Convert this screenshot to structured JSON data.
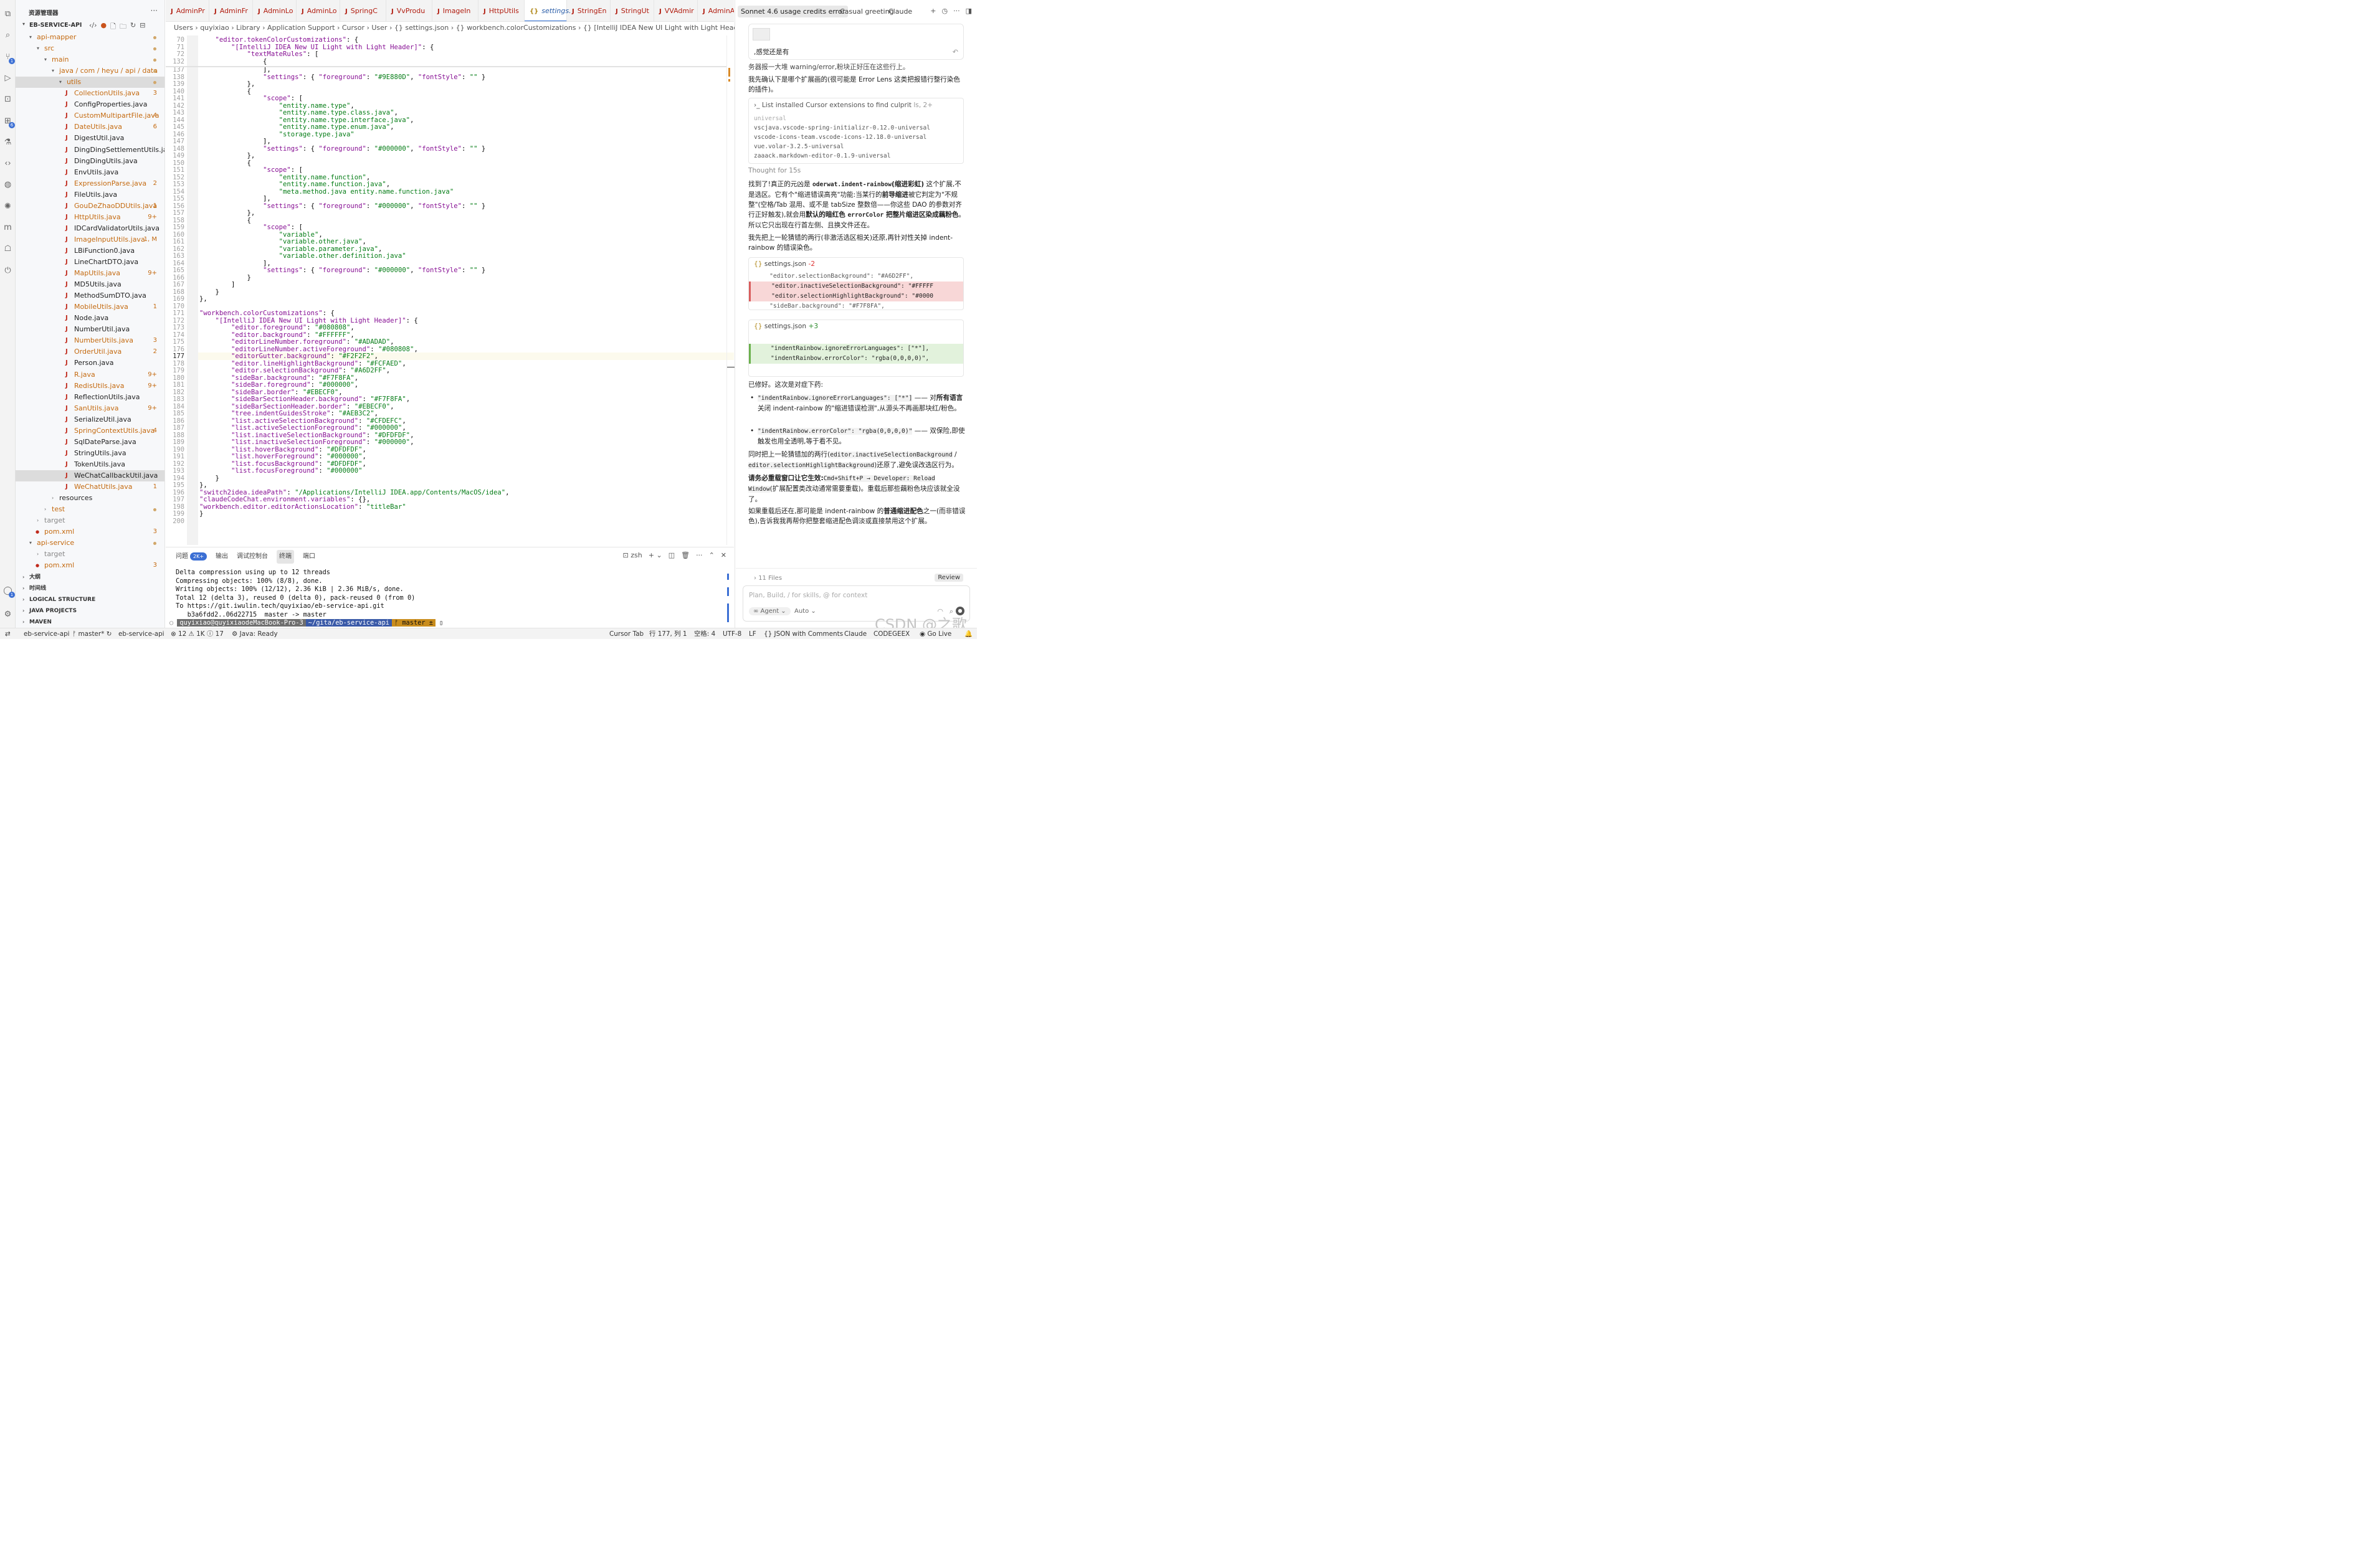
{
  "activity_bar": {
    "items": [
      {
        "icon": "files-icon"
      },
      {
        "icon": "search-icon"
      },
      {
        "icon": "source-control-icon",
        "badge": "1"
      },
      {
        "icon": "run-debug-icon"
      },
      {
        "icon": "remote-explorer-icon"
      },
      {
        "icon": "extensions-icon",
        "badge": "6"
      },
      {
        "icon": "testing-icon"
      },
      {
        "icon": "code-icon"
      },
      {
        "icon": "chat-icon"
      },
      {
        "icon": "spark-icon"
      },
      {
        "icon": "maven-icon"
      },
      {
        "icon": "robot-icon"
      },
      {
        "icon": "power-icon"
      }
    ],
    "bottom": [
      {
        "icon": "account-icon",
        "badge": "1"
      },
      {
        "icon": "gear-icon"
      }
    ]
  },
  "sidebar": {
    "title": "资源管理器",
    "more": "···",
    "project": "EB-SERVICE-API",
    "tree": [
      {
        "label": "api-mapper",
        "depth": 1,
        "kind": "folder",
        "open": true,
        "color": "#c46a10",
        "dot": true
      },
      {
        "label": "src",
        "depth": 2,
        "kind": "folder",
        "open": true,
        "color": "#c46a10",
        "dot": true
      },
      {
        "label": "main",
        "depth": 3,
        "kind": "folder",
        "open": true,
        "color": "#c46a10",
        "dot": true
      },
      {
        "label": "java / com / heyu / api / data",
        "depth": 4,
        "kind": "folder",
        "open": true,
        "color": "#c46a10",
        "dot": true
      },
      {
        "label": "utils",
        "depth": 5,
        "kind": "folder",
        "open": true,
        "color": "#c46a10",
        "dot": true,
        "selected": true
      },
      {
        "label": "CollectionUtils.java",
        "depth": 6,
        "kind": "java",
        "color": "#c46a10",
        "count": "3"
      },
      {
        "label": "ConfigProperties.java",
        "depth": 6,
        "kind": "java",
        "color": "#222"
      },
      {
        "label": "CustomMultipartFile.java",
        "depth": 6,
        "kind": "java",
        "color": "#c46a10",
        "count": "4"
      },
      {
        "label": "DateUtils.java",
        "depth": 6,
        "kind": "java",
        "color": "#c46a10",
        "count": "6"
      },
      {
        "label": "DigestUtil.java",
        "depth": 6,
        "kind": "java",
        "color": "#222"
      },
      {
        "label": "DingDingSettlementUtils.java",
        "depth": 6,
        "kind": "java",
        "color": "#222"
      },
      {
        "label": "DingDingUtils.java",
        "depth": 6,
        "kind": "java",
        "color": "#222"
      },
      {
        "label": "EnvUtils.java",
        "depth": 6,
        "kind": "java",
        "color": "#222"
      },
      {
        "label": "ExpressionParse.java",
        "depth": 6,
        "kind": "java",
        "color": "#c46a10",
        "count": "2"
      },
      {
        "label": "FileUtils.java",
        "depth": 6,
        "kind": "java",
        "color": "#222"
      },
      {
        "label": "GouDeZhaoDDUtils.java",
        "depth": 6,
        "kind": "java",
        "color": "#c46a10",
        "count": "1"
      },
      {
        "label": "HttpUtils.java",
        "depth": 6,
        "kind": "java",
        "color": "#c46a10",
        "count": "9+"
      },
      {
        "label": "IDCardValidatorUtils.java",
        "depth": 6,
        "kind": "java",
        "color": "#222"
      },
      {
        "label": "ImageInputUtils.java",
        "depth": 6,
        "kind": "java",
        "color": "#c46a10",
        "count": "1, M"
      },
      {
        "label": "LBiFunction0.java",
        "depth": 6,
        "kind": "java",
        "color": "#222"
      },
      {
        "label": "LineChartDTO.java",
        "depth": 6,
        "kind": "java",
        "color": "#222"
      },
      {
        "label": "MapUtils.java",
        "depth": 6,
        "kind": "java",
        "color": "#c46a10",
        "count": "9+"
      },
      {
        "label": "MD5Utils.java",
        "depth": 6,
        "kind": "java",
        "color": "#222"
      },
      {
        "label": "MethodSumDTO.java",
        "depth": 6,
        "kind": "java",
        "color": "#222"
      },
      {
        "label": "MobileUtils.java",
        "depth": 6,
        "kind": "java",
        "color": "#c46a10",
        "count": "1"
      },
      {
        "label": "Node.java",
        "depth": 6,
        "kind": "java",
        "color": "#222"
      },
      {
        "label": "NumberUtil.java",
        "depth": 6,
        "kind": "java",
        "color": "#222"
      },
      {
        "label": "NumberUtils.java",
        "depth": 6,
        "kind": "java",
        "color": "#c46a10",
        "count": "3"
      },
      {
        "label": "OrderUtil.java",
        "depth": 6,
        "kind": "java",
        "color": "#c46a10",
        "count": "2"
      },
      {
        "label": "Person.java",
        "depth": 6,
        "kind": "java",
        "color": "#222"
      },
      {
        "label": "R.java",
        "depth": 6,
        "kind": "java",
        "color": "#c46a10",
        "count": "9+"
      },
      {
        "label": "RedisUtils.java",
        "depth": 6,
        "kind": "java",
        "color": "#c46a10",
        "count": "9+"
      },
      {
        "label": "ReflectionUtils.java",
        "depth": 6,
        "kind": "java",
        "color": "#222"
      },
      {
        "label": "SanUtils.java",
        "depth": 6,
        "kind": "java",
        "color": "#c46a10",
        "count": "9+"
      },
      {
        "label": "SerializeUtil.java",
        "depth": 6,
        "kind": "java",
        "color": "#222"
      },
      {
        "label": "SpringContextUtils.java",
        "depth": 6,
        "kind": "java",
        "color": "#c46a10",
        "count": "4"
      },
      {
        "label": "SqlDateParse.java",
        "depth": 6,
        "kind": "java",
        "color": "#222"
      },
      {
        "label": "StringUtils.java",
        "depth": 6,
        "kind": "java",
        "color": "#222"
      },
      {
        "label": "TokenUtils.java",
        "depth": 6,
        "kind": "java",
        "color": "#222"
      },
      {
        "label": "WeChatCallbackUtil.java",
        "depth": 6,
        "kind": "java",
        "color": "#222",
        "selected": true
      },
      {
        "label": "WeChatUtils.java",
        "depth": 6,
        "kind": "java",
        "color": "#c46a10",
        "count": "1"
      },
      {
        "label": "resources",
        "depth": 4,
        "kind": "folder",
        "open": false,
        "color": "#222"
      },
      {
        "label": "test",
        "depth": 3,
        "kind": "folder",
        "open": false,
        "color": "#c46a10",
        "dot": true
      },
      {
        "label": "target",
        "depth": 2,
        "kind": "folder",
        "open": false,
        "color": "#888"
      },
      {
        "label": "pom.xml",
        "depth": 2,
        "kind": "xml",
        "color": "#c46a10",
        "count": "3"
      },
      {
        "label": "api-service",
        "depth": 1,
        "kind": "folder",
        "open": true,
        "color": "#c46a10",
        "dot": true
      },
      {
        "label": "target",
        "depth": 2,
        "kind": "folder",
        "open": false,
        "color": "#888"
      },
      {
        "label": "pom.xml",
        "depth": 2,
        "kind": "xml",
        "color": "#c46a10",
        "count": "3"
      }
    ],
    "sections": [
      "大纲",
      "时间线",
      "LOGICAL STRUCTURE",
      "JAVA PROJECTS",
      "MAVEN"
    ]
  },
  "editor": {
    "tabs": [
      {
        "label": "AdminPr",
        "active": false
      },
      {
        "label": "AdminFr",
        "active": false
      },
      {
        "label": "AdminLo",
        "active": false
      },
      {
        "label": "AdminLo",
        "active": false
      },
      {
        "label": "SpringC",
        "active": false
      },
      {
        "label": "VvProdu",
        "active": false
      },
      {
        "label": "ImageIn",
        "active": false
      },
      {
        "label": "HttpUtils",
        "active": false
      },
      {
        "label": "settings.",
        "active": true
      },
      {
        "label": "StringEn",
        "active": false
      },
      {
        "label": "StringUt",
        "active": false
      },
      {
        "label": "VVAdmir",
        "active": false
      },
      {
        "label": "AdminAp",
        "active": false
      }
    ],
    "breadcrumb": "Users › quyixiao › Library › Application Support › Cursor › User › {} settings.json › {} workbench.colorCustomizations › {} [IntelliJ IDEA New UI Light with Light Header]",
    "current_line": "177",
    "lines": [
      {
        "n": "70",
        "t": "    \"editor.tokenColorCustomizations\": {"
      },
      {
        "n": "71",
        "t": "        \"[IntelliJ IDEA New UI Light with Light Header]\": {"
      },
      {
        "n": "72",
        "t": "            \"textMateRules\": ["
      },
      {
        "n": "132",
        "t": "                {"
      },
      {
        "n": "137",
        "t": "                ],"
      },
      {
        "n": "138",
        "t": "                \"settings\": { \"foreground\": \"#9E880D\", \"fontStyle\": \"\" }"
      },
      {
        "n": "139",
        "t": "            },"
      },
      {
        "n": "140",
        "t": "            {"
      },
      {
        "n": "141",
        "t": "                \"scope\": ["
      },
      {
        "n": "142",
        "t": "                    \"entity.name.type\","
      },
      {
        "n": "143",
        "t": "                    \"entity.name.type.class.java\","
      },
      {
        "n": "144",
        "t": "                    \"entity.name.type.interface.java\","
      },
      {
        "n": "145",
        "t": "                    \"entity.name.type.enum.java\","
      },
      {
        "n": "146",
        "t": "                    \"storage.type.java\""
      },
      {
        "n": "147",
        "t": "                ],"
      },
      {
        "n": "148",
        "t": "                \"settings\": { \"foreground\": \"#000000\", \"fontStyle\": \"\" }"
      },
      {
        "n": "149",
        "t": "            },"
      },
      {
        "n": "150",
        "t": "            {"
      },
      {
        "n": "151",
        "t": "                \"scope\": ["
      },
      {
        "n": "152",
        "t": "                    \"entity.name.function\","
      },
      {
        "n": "153",
        "t": "                    \"entity.name.function.java\","
      },
      {
        "n": "154",
        "t": "                    \"meta.method.java entity.name.function.java\""
      },
      {
        "n": "155",
        "t": "                ],"
      },
      {
        "n": "156",
        "t": "                \"settings\": { \"foreground\": \"#000000\", \"fontStyle\": \"\" }"
      },
      {
        "n": "157",
        "t": "            },"
      },
      {
        "n": "158",
        "t": "            {"
      },
      {
        "n": "159",
        "t": "                \"scope\": ["
      },
      {
        "n": "160",
        "t": "                    \"variable\","
      },
      {
        "n": "161",
        "t": "                    \"variable.other.java\","
      },
      {
        "n": "162",
        "t": "                    \"variable.parameter.java\","
      },
      {
        "n": "163",
        "t": "                    \"variable.other.definition.java\""
      },
      {
        "n": "164",
        "t": "                ],"
      },
      {
        "n": "165",
        "t": "                \"settings\": { \"foreground\": \"#000000\", \"fontStyle\": \"\" }"
      },
      {
        "n": "166",
        "t": "            }"
      },
      {
        "n": "167",
        "t": "        ]"
      },
      {
        "n": "168",
        "t": "    }"
      },
      {
        "n": "169",
        "t": "},"
      },
      {
        "n": "170",
        "t": ""
      },
      {
        "n": "171",
        "t": "\"workbench.colorCustomizations\": {"
      },
      {
        "n": "172",
        "t": "    \"[IntelliJ IDEA New UI Light with Light Header]\": {"
      },
      {
        "n": "173",
        "t": "        \"editor.foreground\": \"#080808\","
      },
      {
        "n": "174",
        "t": "        \"editor.background\": \"#FFFFFF\","
      },
      {
        "n": "175",
        "t": "        \"editorLineNumber.foreground\": \"#ADADAD\","
      },
      {
        "n": "176",
        "t": "        \"editorLineNumber.activeForeground\": \"#080808\","
      },
      {
        "n": "177",
        "t": "        \"editorGutter.background\": \"#F2F2F2\","
      },
      {
        "n": "178",
        "t": "        \"editor.lineHighlightBackground\": \"#FCFAED\","
      },
      {
        "n": "179",
        "t": "        \"editor.selectionBackground\": \"#A6D2FF\","
      },
      {
        "n": "180",
        "t": "        \"sideBar.background\": \"#F7F8FA\","
      },
      {
        "n": "181",
        "t": "        \"sideBar.foreground\": \"#000000\","
      },
      {
        "n": "182",
        "t": "        \"sideBar.border\": \"#EBECF0\","
      },
      {
        "n": "183",
        "t": "        \"sideBarSectionHeader.background\": \"#F7F8FA\","
      },
      {
        "n": "184",
        "t": "        \"sideBarSectionHeader.border\": \"#EBECF0\","
      },
      {
        "n": "185",
        "t": "        \"tree.indentGuidesStroke\": \"#AEB3C2\","
      },
      {
        "n": "186",
        "t": "        \"list.activeSelectionBackground\": \"#CFDEFC\","
      },
      {
        "n": "187",
        "t": "        \"list.activeSelectionForeground\": \"#000000\","
      },
      {
        "n": "188",
        "t": "        \"list.inactiveSelectionBackground\": \"#DFDFDF\","
      },
      {
        "n": "189",
        "t": "        \"list.inactiveSelectionForeground\": \"#000000\","
      },
      {
        "n": "190",
        "t": "        \"list.hoverBackground\": \"#DFDFDF\","
      },
      {
        "n": "191",
        "t": "        \"list.hoverForeground\": \"#000000\","
      },
      {
        "n": "192",
        "t": "        \"list.focusBackground\": \"#DFDFDF\","
      },
      {
        "n": "193",
        "t": "        \"list.focusForeground\": \"#000000\""
      },
      {
        "n": "194",
        "t": "    }"
      },
      {
        "n": "195",
        "t": "},"
      },
      {
        "n": "196",
        "t": "\"switch2idea.ideaPath\": \"/Applications/IntelliJ IDEA.app/Contents/MacOS/idea\","
      },
      {
        "n": "197",
        "t": "\"claudeCodeChat.environment.variables\": {},"
      },
      {
        "n": "198",
        "t": "\"workbench.editor.editorActionsLocation\": \"titleBar\""
      },
      {
        "n": "199",
        "t": "}"
      },
      {
        "n": "200",
        "t": ""
      }
    ]
  },
  "panel": {
    "tabs": [
      "问题",
      "输出",
      "调试控制台",
      "终端",
      "端口"
    ],
    "problems_badge": "2K+",
    "active": "终端",
    "shell": "zsh",
    "terminal": [
      "Delta compression using up to 12 threads",
      "Compressing objects: 100% (8/8), done.",
      "Writing objects: 100% (12/12), 2.36 KiB | 2.36 MiB/s, done.",
      "Total 12 (delta 3), reused 0 (delta 0), pack-reused 0 (from 0)",
      "To https://git.iwulin.tech/quyixiao/eb-service-api.git",
      "   b3a6fdd2..06d22715  master -> master"
    ],
    "prompt_user": "quyixiao@quyixiaodeMacBook-Pro-3",
    "prompt_path": "~/gita/eb-service-api",
    "prompt_branch": "ᚠ master ±"
  },
  "chat": {
    "tabs": [
      "Sonnet 4.6 usage credits error",
      "Casual greeting",
      "Claude"
    ],
    "active_tab": "Sonnet 4.6 usage credits error",
    "quote": ",感觉还是有",
    "p_cut": "务器报一大堆 warning/error,粉块正好压在这些行上。",
    "p1": "我先确认下是哪个扩展画的(很可能是 Error Lens 这类把报错行整行染色的插件)。",
    "tool_title": "List installed Cursor extensions to find culprit",
    "tool_meta": "ls, 2+",
    "tool_output": [
      "universal",
      "vscjava.vscode-spring-initializr-0.12.0-universal",
      "vscode-icons-team.vscode-icons-12.18.0-universal",
      "vue.volar-3.2.5-universal",
      "zaaack.markdown-editor-0.1.9-universal"
    ],
    "thought_label": "Thought",
    "thought_time": "for 15s",
    "p2a": "找到了!真正的元凶是 ",
    "p2code": "oderwat.indent-rainbow",
    "p2b": "(缩进彩虹)",
    "p2c": " 这个扩展,不是选区。它有个\"缩进错误高亮\"功能:当某行的",
    "p2d": "前导缩进",
    "p2e": "被它判定为\"不规整\"(空格/Tab 混用、或不是 tabSize 整数倍——你这些 DAO 的参数对齐行正好触发),就会用",
    "p2f": "默认的暗红色 ",
    "p2code2": "errorColor",
    "p2g": " 把整片缩进区染成藕粉色",
    "p2h": "。所以它只出现在行首左侧、且换文件还在。",
    "p3": "我先把上一轮猜错的两行(非激活选区相关)还原,再针对性关掉 indent-rainbow 的错误染色。",
    "diff1": {
      "file": "settings.json",
      "stat": "-2",
      "lines": [
        {
          "t": "    \"editor.selectionBackground\": \"#A6D2FF\",",
          "kind": "ctx"
        },
        {
          "t": "    \"editor.inactiveSelectionBackground\": \"#FFFFF",
          "kind": "del"
        },
        {
          "t": "    \"editor.selectionHighlightBackground\": \"#0000",
          "kind": "del"
        },
        {
          "t": "    \"sideBar.background\": \"#F7F8FA\",",
          "kind": "ctx"
        }
      ]
    },
    "diff2": {
      "file": "settings.json",
      "stat": "+3",
      "lines": [
        {
          "t": "\"indentRainbow.ignoreErrorLanguages\": [\"*\"],",
          "kind": "add"
        },
        {
          "t": "\"indentRainbow.errorColor\": \"rgba(0,0,0,0)\",",
          "kind": "add"
        }
      ]
    },
    "p4": "已修好。这次是对症下药:",
    "b1code": "\"indentRainbow.ignoreErrorLanguages\": [\"*\"]",
    "b1a": " —— 对",
    "b1b": "所有语言",
    "b1c": "关闭 indent-rainbow 的\"缩进错误检测\",从源头不再画那块红/粉色。",
    "b2code": "\"indentRainbow.errorColor\": \"rgba(0,0,0,0)\"",
    "b2a": " —— 双保险,即使触发也用全透明,等于看不见。",
    "p5a": "同时把上一轮猜错加的两行(",
    "p5code1": "editor.inactiveSelectionBackground",
    "p5b": " / ",
    "p5code2": "editor.selectionHighlightBackground",
    "p5c": ")还原了,避免误改选区行为。",
    "p6a": "请务必重载窗口让它生效:",
    "p6code": "Cmd+Shift+P → Developer: Reload Window",
    "p6b": "(扩展配置类改动通常需要重载)。重载后那些藕粉色块应该就全没了。",
    "p7a": "如果重载后还在,那可能是 indent-rainbow 的",
    "p7b": "普通缩进配色",
    "p7c": "之一(而非错误色),告诉我我再帮你把整套缩进配色调淡或直接禁用这个扩展。",
    "files": "11 Files",
    "review": "Review",
    "input_placeholder": "Plan, Build, / for skills, @ for context",
    "agent": "Agent",
    "model": "Auto"
  },
  "status": {
    "branch_left": "eb-service-api",
    "branch": "master*",
    "folder": "eb-service-api",
    "errors": "12",
    "warnings": "1K",
    "infos": "17",
    "java": "Java: Ready",
    "cursor_tab": "Cursor Tab",
    "pos": "行 177, 列 1",
    "spaces": "空格: 4",
    "enc": "UTF-8",
    "eol": "LF",
    "lang": "JSON with Comments",
    "claude": "Claude",
    "codegeex": "CODEGEEX",
    "golive": "Go Live"
  },
  "watermark": "CSDN @之歌"
}
